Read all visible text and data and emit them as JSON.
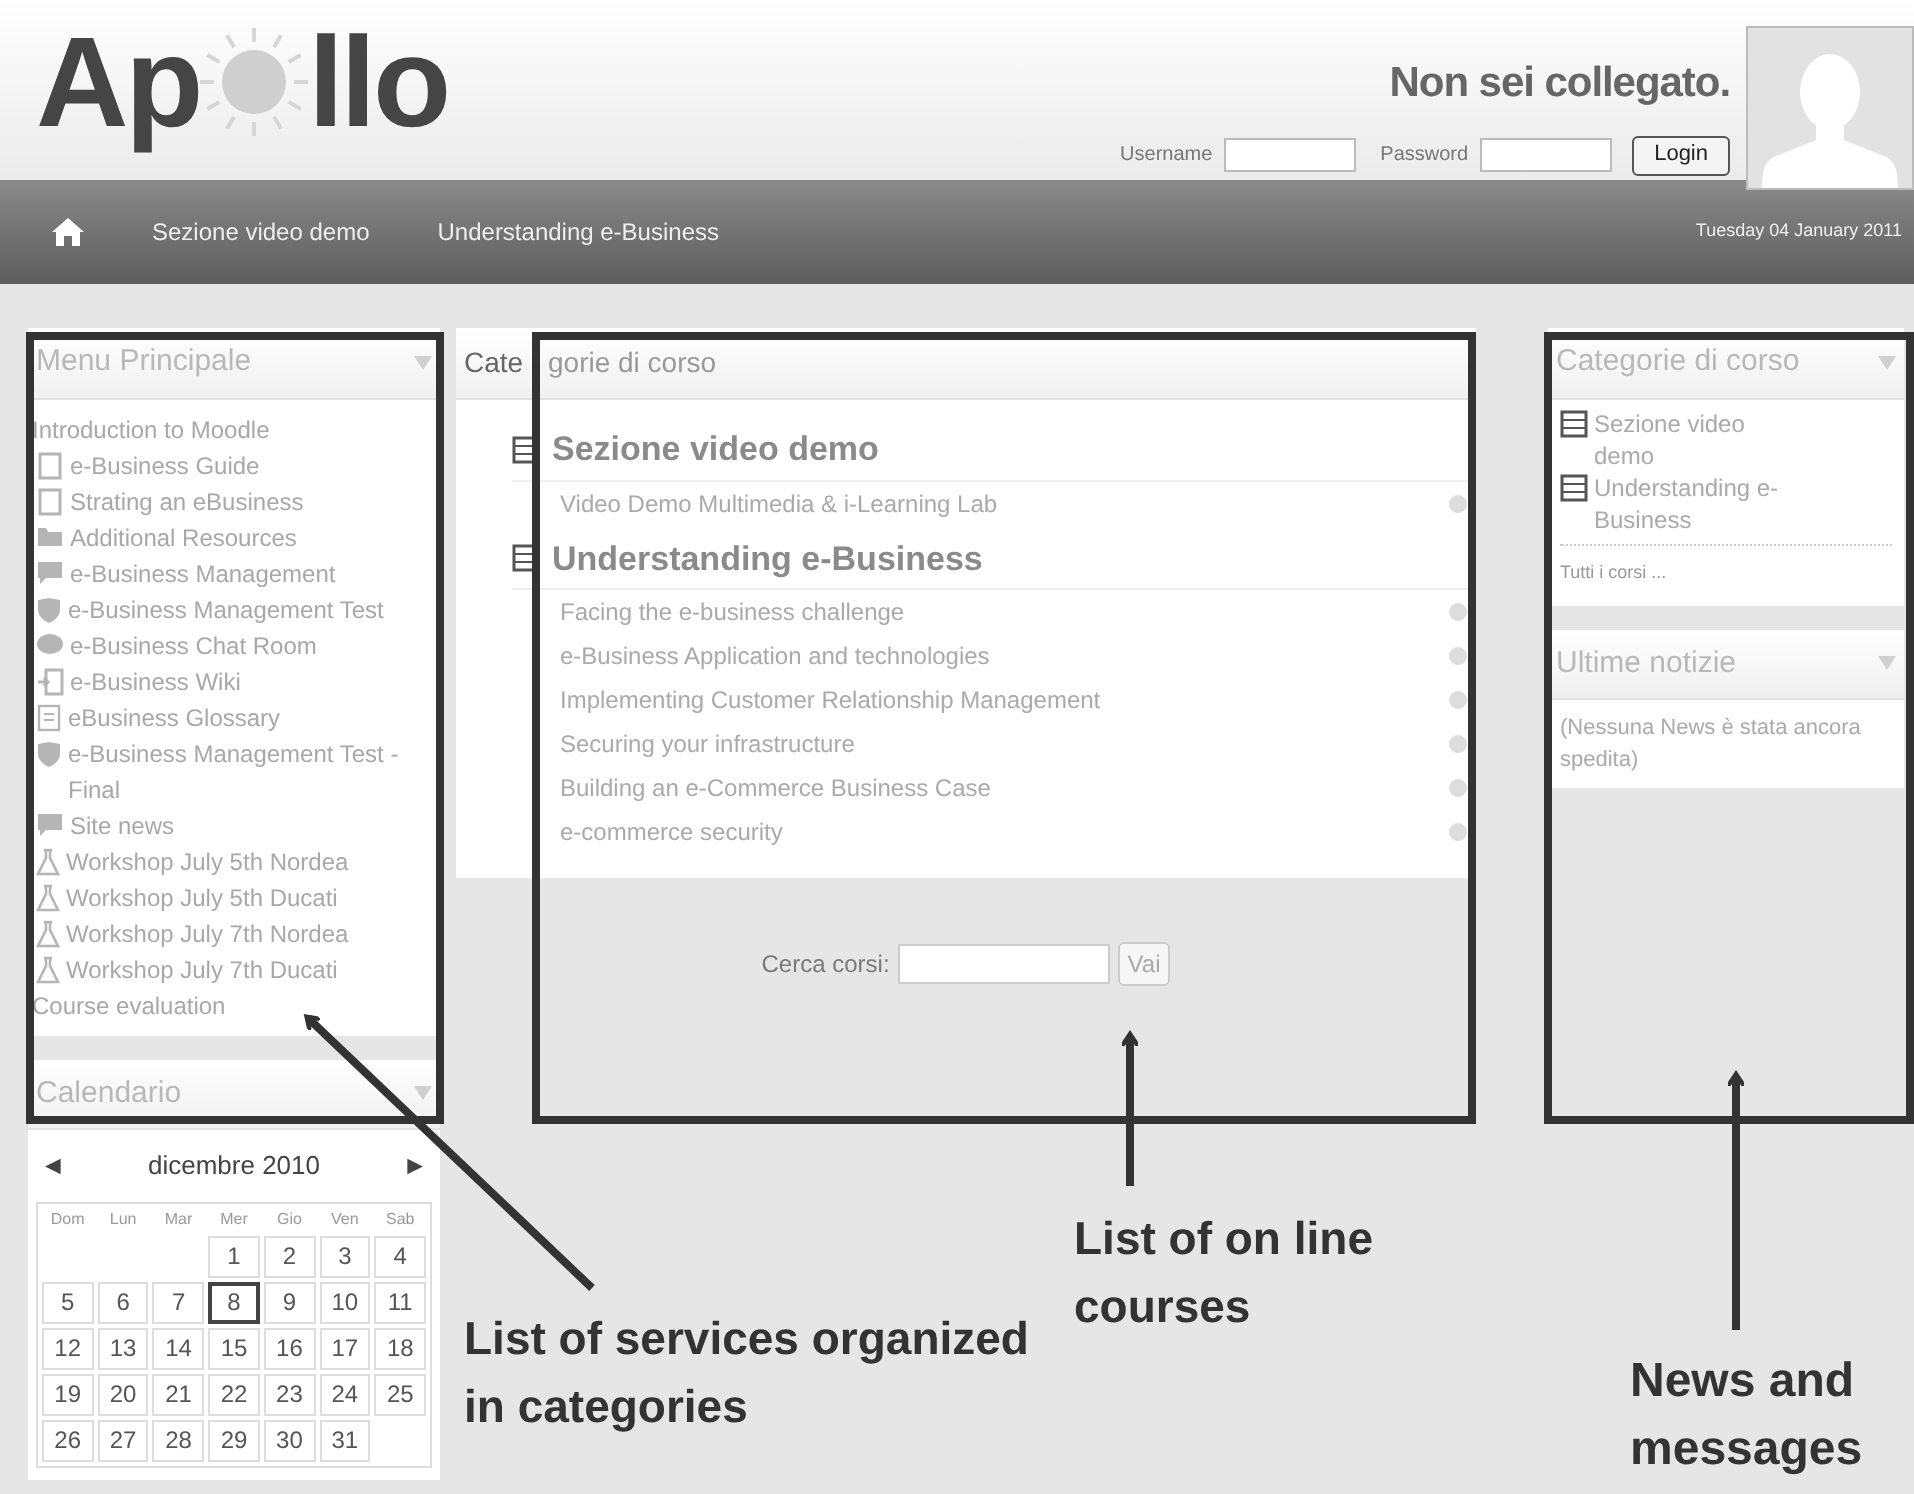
{
  "header": {
    "logo_start": "Ap",
    "logo_end": "llo",
    "status": "Non sei collegato.",
    "username_label": "Username",
    "password_label": "Password",
    "login_button": "Login"
  },
  "nav": {
    "items": [
      "Sezione video demo",
      "Understanding e-Business"
    ],
    "date": "Tuesday 04 January 2011"
  },
  "main_menu": {
    "title": "Menu Principale",
    "items": [
      {
        "label": "Introduction to Moodle",
        "kind": "plain"
      },
      {
        "label": "e-Business Guide",
        "kind": "page"
      },
      {
        "label": "Strating an eBusiness",
        "kind": "page"
      },
      {
        "label": "Additional Resources",
        "kind": "folder"
      },
      {
        "label": "e-Business Management",
        "kind": "forum"
      },
      {
        "label": "e-Business Management Test",
        "kind": "quiz"
      },
      {
        "label": "e-Business Chat Room",
        "kind": "chat"
      },
      {
        "label": "e-Business Wiki",
        "kind": "wiki"
      },
      {
        "label": "eBusiness Glossary",
        "kind": "glossary"
      },
      {
        "label": "e-Business Management Test - Final",
        "kind": "quiz"
      },
      {
        "label": "Site news",
        "kind": "forum"
      },
      {
        "label": "Workshop July 5th Nordea",
        "kind": "workshop"
      },
      {
        "label": "Workshop July 5th Ducati",
        "kind": "workshop"
      },
      {
        "label": "Workshop July 7th Nordea",
        "kind": "workshop"
      },
      {
        "label": "Workshop July 7th Ducati",
        "kind": "workshop"
      },
      {
        "label": "Course evaluation",
        "kind": "plain"
      }
    ]
  },
  "calendar": {
    "title": "Calendario",
    "prev": "◄",
    "next": "►",
    "month": "dicembre 2010",
    "weekdays": [
      "Dom",
      "Lun",
      "Mar",
      "Mer",
      "Gio",
      "Ven",
      "Sab"
    ],
    "weeks": [
      [
        {
          "kind": "blank"
        },
        {
          "kind": "blank"
        },
        {
          "kind": "blank"
        },
        {
          "day": "1",
          "selected": false
        },
        {
          "day": "2",
          "selected": false
        },
        {
          "day": "3",
          "selected": false
        },
        {
          "day": "4",
          "selected": false
        }
      ],
      [
        {
          "day": "5",
          "selected": false
        },
        {
          "day": "6",
          "selected": false
        },
        {
          "day": "7",
          "selected": false
        },
        {
          "day": "8",
          "selected": true
        },
        {
          "day": "9",
          "selected": false
        },
        {
          "day": "10",
          "selected": false
        },
        {
          "day": "11",
          "selected": false
        }
      ],
      [
        {
          "day": "12",
          "selected": false
        },
        {
          "day": "13",
          "selected": false
        },
        {
          "day": "14",
          "selected": false
        },
        {
          "day": "15",
          "selected": false
        },
        {
          "day": "16",
          "selected": false
        },
        {
          "day": "17",
          "selected": false
        },
        {
          "day": "18",
          "selected": false
        }
      ],
      [
        {
          "day": "19",
          "selected": false
        },
        {
          "day": "20",
          "selected": false
        },
        {
          "day": "21",
          "selected": false
        },
        {
          "day": "22",
          "selected": false
        },
        {
          "day": "23",
          "selected": false
        },
        {
          "day": "24",
          "selected": false
        },
        {
          "day": "25",
          "selected": false
        }
      ],
      [
        {
          "day": "26",
          "selected": false
        },
        {
          "day": "27",
          "selected": false
        },
        {
          "day": "28",
          "selected": false
        },
        {
          "day": "29",
          "selected": false
        },
        {
          "day": "30",
          "selected": false
        },
        {
          "day": "31",
          "selected": false
        },
        {
          "kind": "blank"
        }
      ]
    ]
  },
  "course_categories": {
    "title_start": "Cate",
    "title_end": "gorie di corso",
    "categories": [
      {
        "name": "Sezione video demo",
        "courses": [
          "Video Demo Multimedia & i-Learning Lab"
        ]
      },
      {
        "name": "Understanding e-Business",
        "courses": [
          "Facing the e-business challenge",
          "e-Business Application and technologies",
          "Implementing Customer Relationship Management",
          "Securing your infrastructure",
          "Building an e-Commerce Business Case",
          "e-commerce security"
        ]
      }
    ],
    "search_label": "Cerca corsi:",
    "search_button": "Vai"
  },
  "side_categories": {
    "title": "Categorie di corso",
    "items": [
      "Sezione video demo",
      "Understanding e-Business"
    ],
    "all_link": "Tutti i corsi ..."
  },
  "news": {
    "title": "Ultime notizie",
    "text": "(Nessuna News è stata ancora spedita)"
  },
  "annotations": [
    "List of services organized in categories",
    "List of on line courses",
    "News and messages"
  ]
}
